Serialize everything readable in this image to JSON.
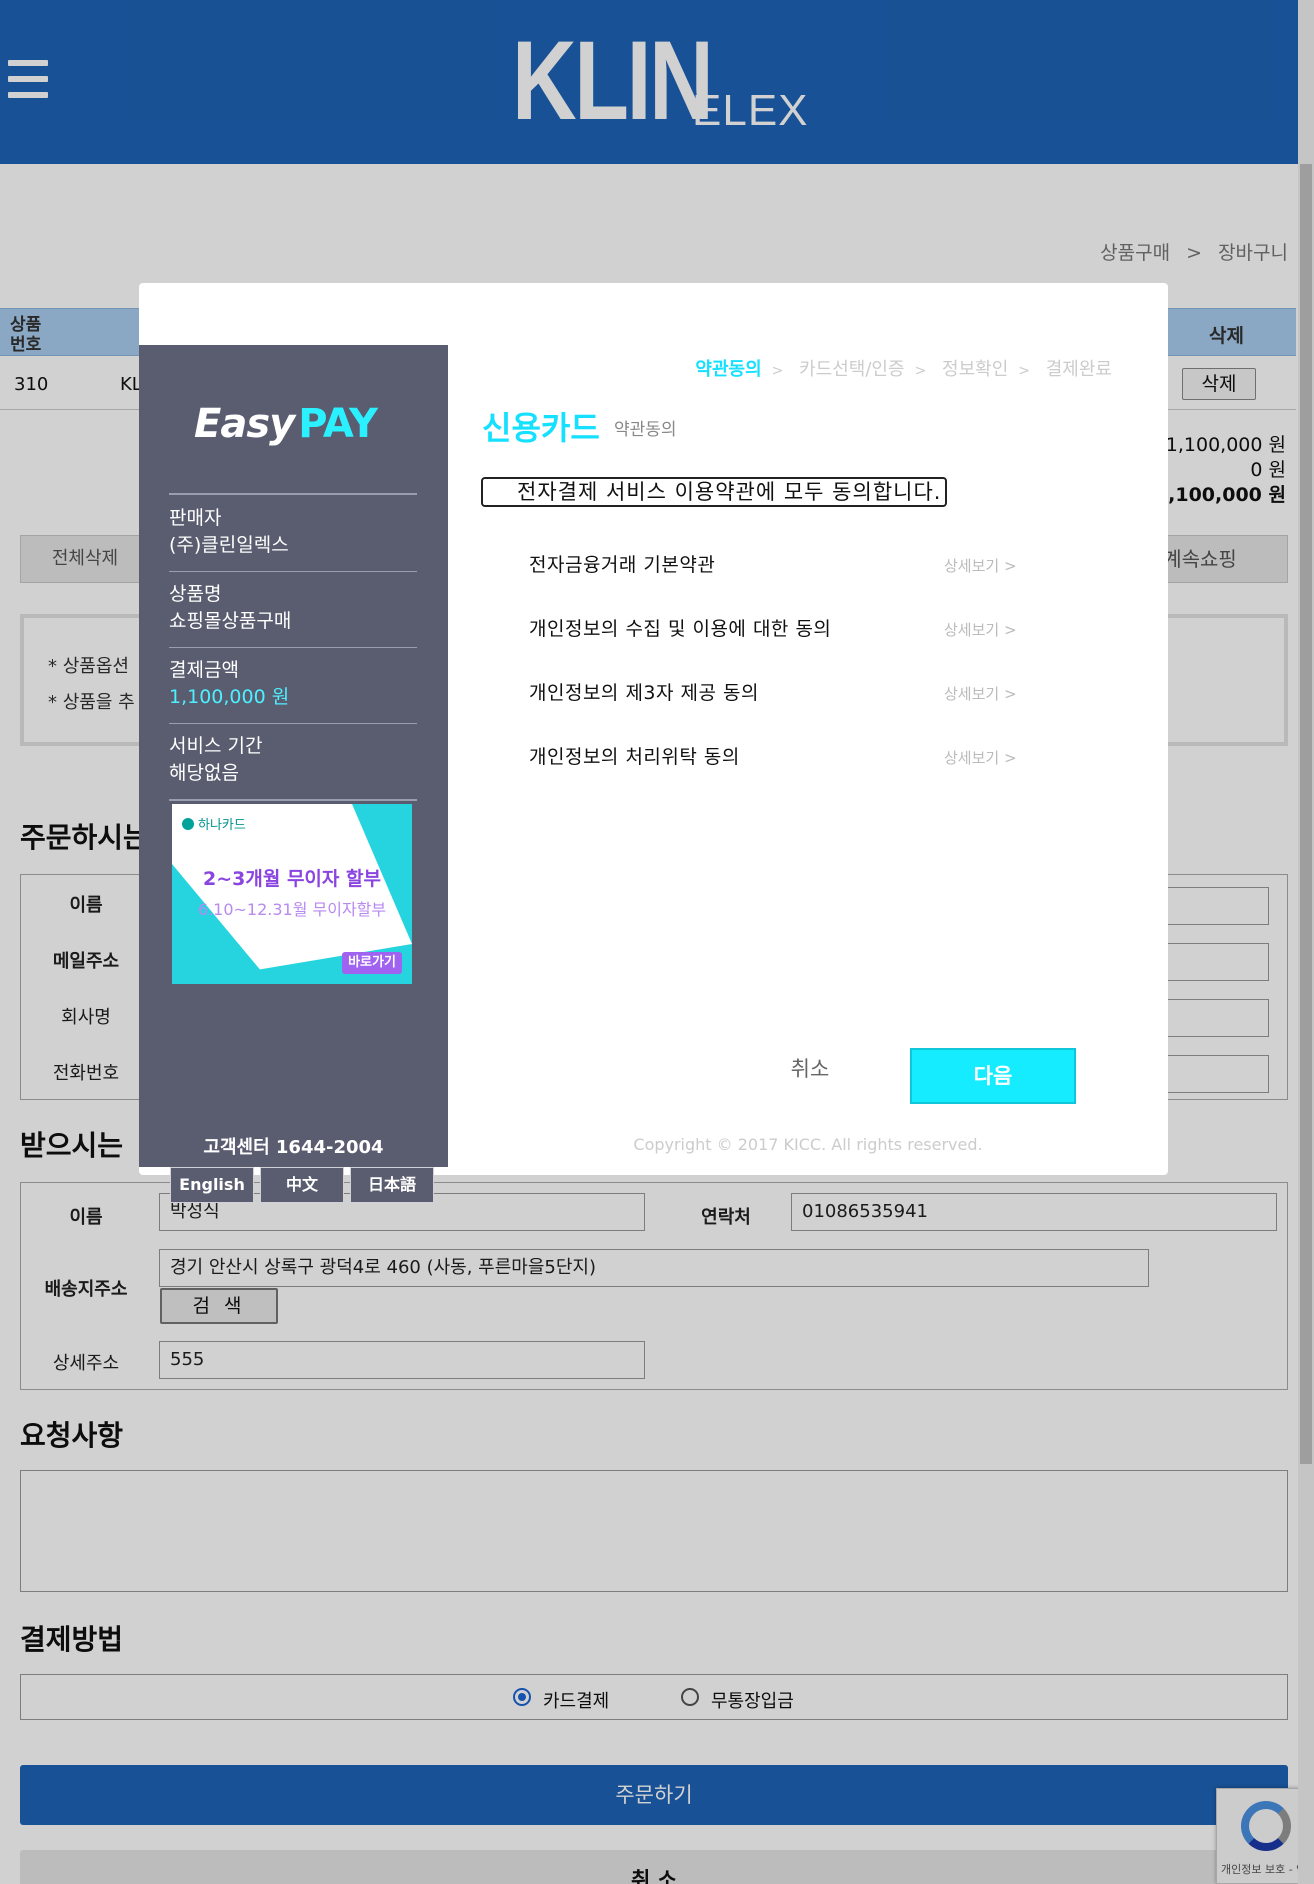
{
  "header": {
    "brand": "KLIN",
    "brand_sub": "ELEX"
  },
  "breadcrumb": {
    "item1": "상품구매",
    "sep": ">",
    "item2": "장바구니"
  },
  "cart": {
    "col_no": "상품\n번호",
    "col_delete": "삭제",
    "row": {
      "no": "310",
      "name": "KL",
      "delete_label": "삭제"
    },
    "sum_total": "1,100,000 원",
    "sum_discount": "0 원",
    "sum_pay": "1,100,000 원",
    "delete_all_label": "전체삭제",
    "continue_label": "계속쇼핑",
    "notice1": "* 상품옵션",
    "notice2": "* 상품을 추"
  },
  "orderer": {
    "title": "주문하시는",
    "name_label": "이름",
    "email_label": "메일주소",
    "company_label": "회사명",
    "phone_label": "전화번호"
  },
  "receiver": {
    "title": "받으시는",
    "name_label": "이름",
    "name_value": "박성식",
    "contact_label": "연락처",
    "contact_value": "01086535941",
    "address_label": "배송지주소",
    "address_value": "경기 안산시 상록구 광덕4로 460 (사동, 푸른마을5단지)",
    "search_label": "검 색",
    "detail_label": "상세주소",
    "detail_value": "555"
  },
  "request": {
    "title": "요청사항"
  },
  "payment": {
    "title": "결제방법",
    "option_card": "카드결제",
    "option_bank": "무통장입금",
    "selected": "카드결제"
  },
  "buttons": {
    "order": "주문하기",
    "cancel": "취 소"
  },
  "recaptcha": {
    "text": "개인정보 보호 - 약"
  },
  "modal": {
    "logo_easy": "Easy",
    "logo_pay": "PAY",
    "seller_label": "판매자",
    "seller_value": "(주)클린일렉스",
    "product_label": "상품명",
    "product_value": "쇼핑몰상품구매",
    "amount_label": "결제금액",
    "amount_value": "1,100,000 원",
    "period_label": "서비스 기간",
    "period_value": "해당없음",
    "banner": {
      "brand": "하나카드",
      "line1": "2~3개월 무이자 할부",
      "line2": "6.10~12.31월 무이자할부",
      "go": "바로가기"
    },
    "customer_center": "고객센터 1644-2004",
    "lang_en": "English",
    "lang_zh": "中文",
    "lang_ja": "日本語",
    "steps": [
      "약관동의",
      "카드선택/인증",
      "정보확인",
      "결제완료"
    ],
    "step_sep": ">",
    "title": "신용카드",
    "subtitle": "약관동의",
    "agree_all": "전자결제 서비스 이용약관에 모두 동의합니다.",
    "terms": [
      "전자금융거래 기본약관",
      "개인정보의 수집 및 이용에 대한 동의",
      "개인정보의 제3자 제공 동의",
      "개인정보의 처리위탁 동의"
    ],
    "detail_label": "상세보기 >",
    "cancel_label": "취소",
    "next_label": "다음",
    "copyright": "Copyright © 2017 KICC. All rights reserved."
  },
  "colors": {
    "header_blue": "#1e63b6",
    "accent_cyan": "#16ecff",
    "side_panel": "#5a5d70"
  }
}
